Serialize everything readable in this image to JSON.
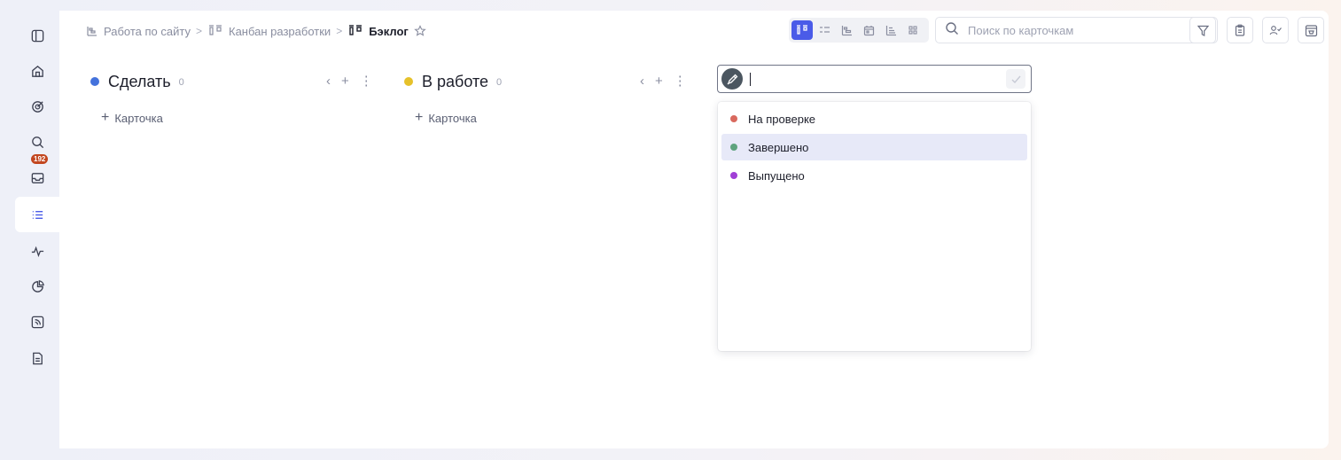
{
  "sidebar": {
    "inbox_badge": "192",
    "icons": [
      "panel-toggle-icon",
      "home-icon",
      "goals-icon",
      "search-icon",
      "inbox-icon",
      "list-icon",
      "activity-icon",
      "reports-icon",
      "feed-icon",
      "document-icon"
    ]
  },
  "breadcrumb": {
    "items": [
      "Работа по сайту",
      "Канбан разработки",
      "Бэклог"
    ],
    "separator": ">"
  },
  "toolbar": {
    "search_placeholder": "Поиск по карточкам",
    "active_view": "kanban",
    "views": [
      "kanban",
      "list",
      "gantt",
      "calendar",
      "timeline",
      "grid"
    ]
  },
  "columns": [
    {
      "title": "Сделать",
      "count": "0",
      "color": "#4472dc",
      "add_label": "Карточка"
    },
    {
      "title": "В работе",
      "count": "0",
      "color": "#e6c12a",
      "add_label": "Карточка"
    }
  ],
  "new_column": {
    "value": "",
    "options": [
      {
        "label": "На проверке",
        "color": "#d9695e"
      },
      {
        "label": "Завершено",
        "color": "#5ea37e"
      },
      {
        "label": "Выпущено",
        "color": "#a03fd6"
      }
    ],
    "highlighted": "Завершено"
  },
  "colors": {
    "accent": "#4a5be8",
    "badge": "#c2461f"
  }
}
